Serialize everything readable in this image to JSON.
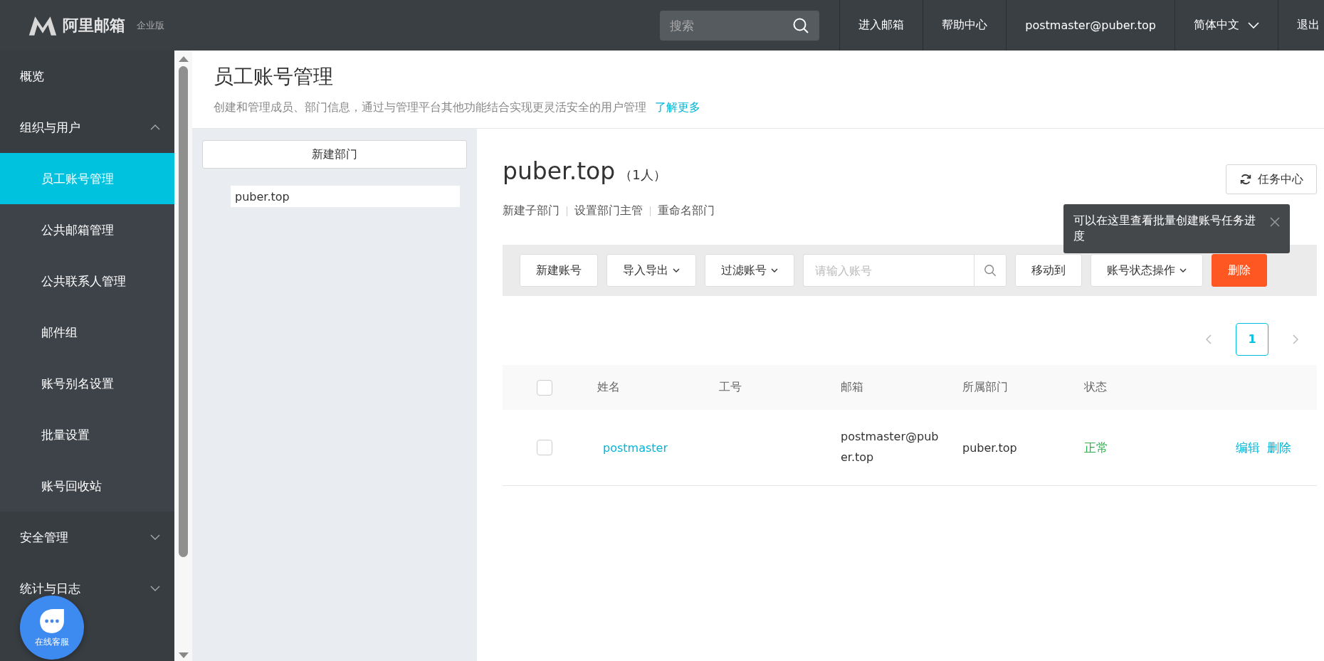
{
  "header": {
    "logo_text": "阿里邮箱",
    "edition": "企业版",
    "search": {
      "placeholder": "搜索"
    },
    "nav": [
      {
        "label": "进入邮箱",
        "kind": "link"
      },
      {
        "label": "帮助中心",
        "kind": "link"
      },
      {
        "label": "postmaster@puber.top",
        "kind": "link"
      },
      {
        "label": "简体中文",
        "kind": "dropdown"
      },
      {
        "label": "退出",
        "kind": "link"
      }
    ]
  },
  "sidebar": {
    "items": [
      {
        "label": "概览",
        "kind": "link",
        "selected": false
      },
      {
        "label": "组织与用户",
        "kind": "group",
        "expanded": true,
        "children": [
          {
            "label": "员工账号管理",
            "selected": true
          },
          {
            "label": "公共邮箱管理",
            "selected": false
          },
          {
            "label": "公共联系人管理",
            "selected": false
          },
          {
            "label": "邮件组",
            "selected": false
          },
          {
            "label": "账号别名设置",
            "selected": false
          },
          {
            "label": "批量设置",
            "selected": false
          },
          {
            "label": "账号回收站",
            "selected": false
          }
        ]
      },
      {
        "label": "安全管理",
        "kind": "group",
        "expanded": false
      },
      {
        "label": "统计与日志",
        "kind": "group",
        "expanded": false
      }
    ]
  },
  "chat_button": {
    "label": "在线客服"
  },
  "page": {
    "title": "员工账号管理",
    "description": "创建和管理成员、部门信息，通过与管理平台其他功能结合实现更灵活安全的用户管理",
    "learn_more": "了解更多"
  },
  "departments": {
    "new_button": "新建部门",
    "tree": [
      {
        "label": "puber.top",
        "selected": true
      }
    ]
  },
  "department": {
    "name": "puber.top",
    "count": "（1人）",
    "actions": [
      "新建子部门",
      "设置部门主管",
      "重命名部门"
    ],
    "task_center": "任务中心",
    "tooltip": "可以在这里查看批量创建账号任务进度"
  },
  "toolbar": {
    "buttons": [
      {
        "label": "新建账号",
        "kind": "plain"
      },
      {
        "label": "导入导出",
        "kind": "dropdown"
      },
      {
        "label": "过滤账号",
        "kind": "dropdown"
      }
    ],
    "account_search": {
      "placeholder": "请输入账号"
    },
    "buttons_after": [
      {
        "label": "移动到",
        "kind": "plain"
      },
      {
        "label": "账号状态操作",
        "kind": "dropdown"
      },
      {
        "label": "删除",
        "kind": "danger"
      }
    ]
  },
  "pagination": {
    "pages": [
      {
        "label": "1",
        "selected": true
      }
    ]
  },
  "table": {
    "columns": [
      "姓名",
      "工号",
      "邮箱",
      "所属部门",
      "状态"
    ],
    "header_checked": false,
    "rows": [
      {
        "checked": false,
        "name": "postmaster",
        "employee_id": "",
        "email": "postmaster@puber.top",
        "department": "puber.top",
        "status": "正常",
        "actions": [
          "编辑",
          "删除"
        ]
      }
    ]
  }
}
